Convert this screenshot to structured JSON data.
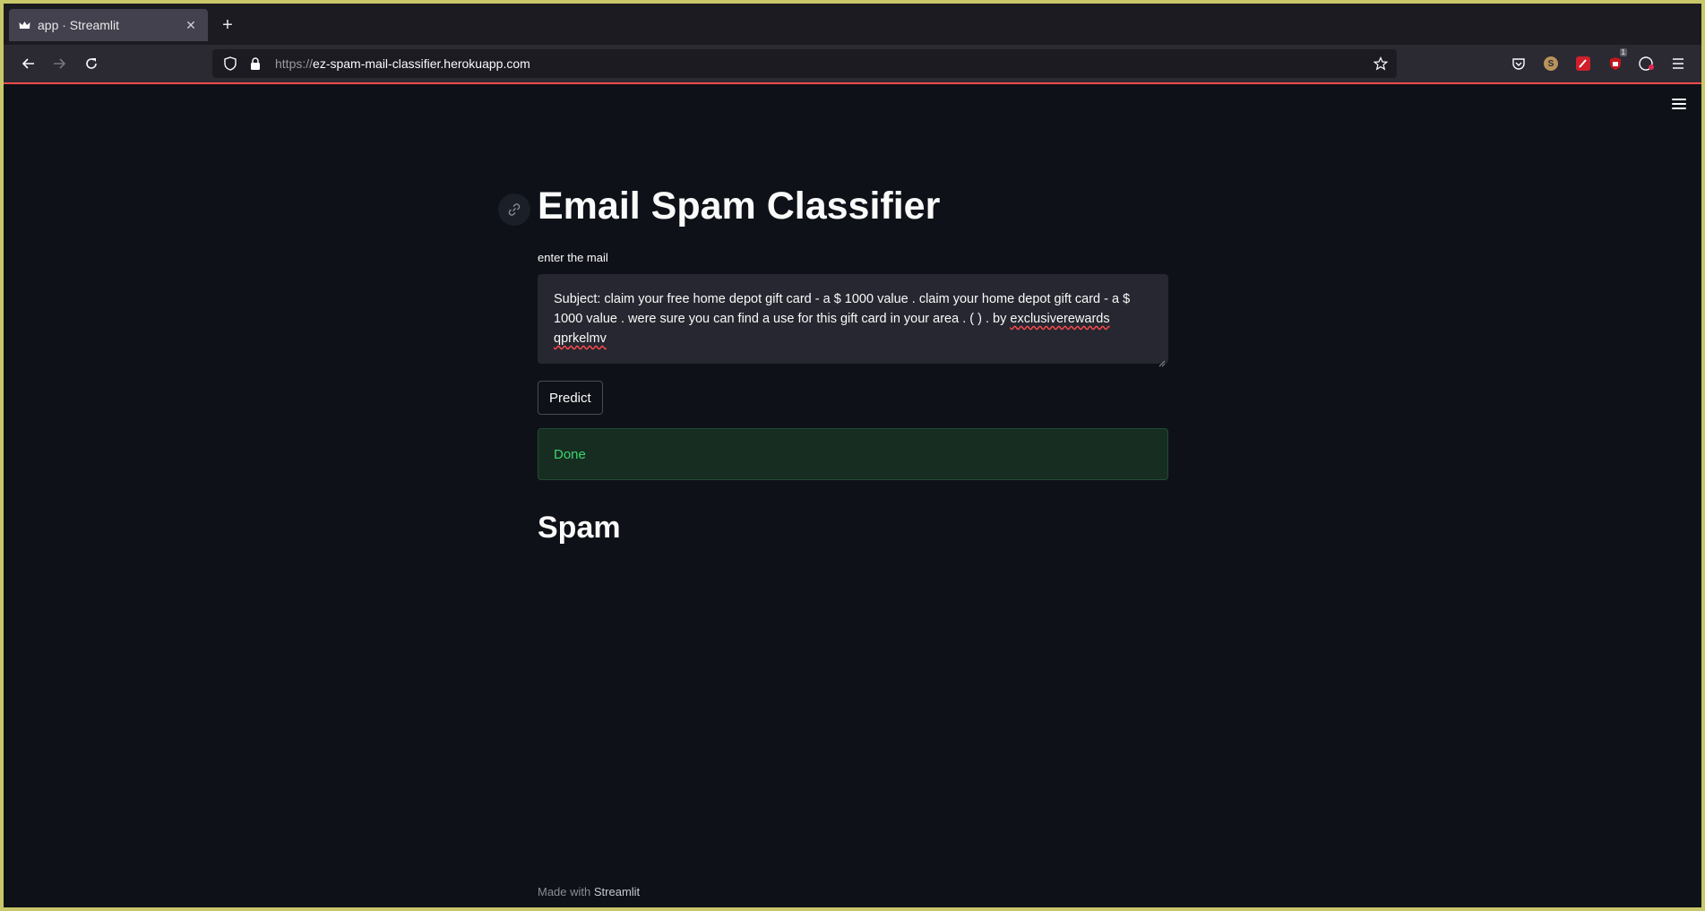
{
  "browser": {
    "tab_title": "app · Streamlit",
    "tab_close": "✕",
    "new_tab": "+",
    "url_scheme": "https://",
    "url_host": "ez-spam-mail-classifier.herokuapp.com",
    "extension_badge": "1",
    "extension_s_label": "S"
  },
  "app": {
    "title": "Email Spam Classifier",
    "input_label": "enter the mail",
    "input_text_part1": "Subject: claim your free home depot gift card - a $ 1000 value .  claim your home depot gift card - a $ 1000 value . were sure you can find a use for this gift card in your area . ( ) .  by ",
    "input_text_misspelled1": "exclusiverewards",
    "input_text_sep": " ",
    "input_text_misspelled2": "qprkelmv",
    "predict_label": "Predict",
    "status_message": "Done",
    "result": "Spam"
  },
  "footer": {
    "made_with": "Made with",
    "brand": "Streamlit"
  },
  "colors": {
    "background": "#0e1117",
    "accent": "#ff4b4b",
    "success_text": "#3dd56d",
    "success_bg": "#172d22"
  }
}
